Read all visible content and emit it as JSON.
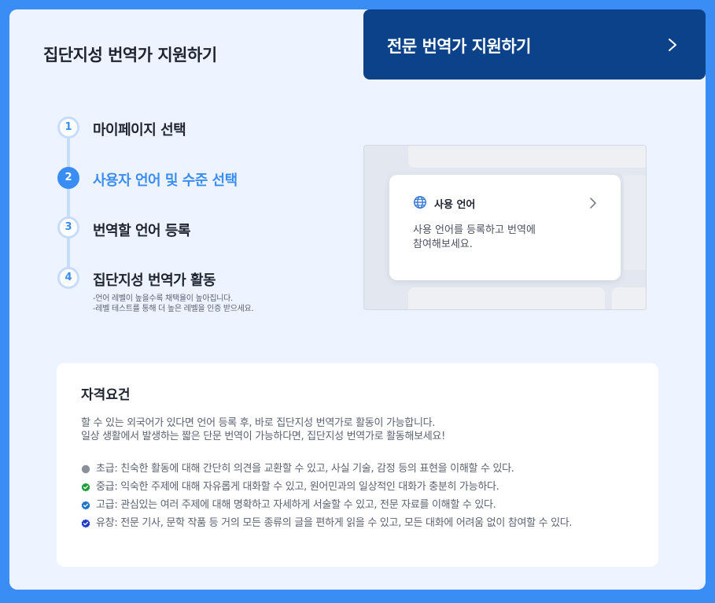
{
  "tabs": {
    "active": {
      "label": "집단지성 번역가 지원하기"
    },
    "other": {
      "label": "전문 번역가 지원하기",
      "icon": "chevron-right-icon"
    }
  },
  "steps": [
    {
      "number": "1",
      "label": "마이페이지 선택",
      "active": false
    },
    {
      "number": "2",
      "label": "사용자 언어 및 수준 선택",
      "active": true
    },
    {
      "number": "3",
      "label": "번역할 언어 등록",
      "active": false
    },
    {
      "number": "4",
      "label": "집단지성 번역가 활동",
      "active": false,
      "notes": [
        "-언어 레벨이 높을수록 채택율이 높아집니다.",
        "-레벨 테스트를 통해 더 높은 레벨을 인증 받으세요."
      ]
    }
  ],
  "preview": {
    "icon": "globe-icon",
    "title": "사용 언어",
    "description_line1": "사용 언어를 등록하고 번역에",
    "description_line2": "참여해보세요."
  },
  "requirements": {
    "title": "자격요건",
    "intro_line1": "할 수 있는 외국어가 있다면 언어 등록 후, 바로 집단지성 번역가로 활동이 가능합니다.",
    "intro_line2": "일상 생활에서 발생하는 짧은 단문 번역이 가능하다면, 집단지성 번역가로 활동해보세요!",
    "levels": [
      {
        "text": "초급: 친숙한 활동에 대해 간단히 의견을 교환할 수 있고, 사실 기술, 감정 등의 표현을 이해할 수 있다.",
        "icon": "gray-dot-icon",
        "color": "#8a8f99"
      },
      {
        "text": "중급: 익숙한 주제에 대해 자유롭게 대화할 수 있고, 원어민과의 일상적인 대화가 충분히 가능하다.",
        "icon": "green-check-badge-icon",
        "color": "#1f9d3a"
      },
      {
        "text": "고급: 관심있는 여러 주제에 대해 명확하고 자세하게 서술할 수 있고, 전문 자료를 이해할 수 있다.",
        "icon": "blue-check-badge-icon",
        "color": "#1e74c8"
      },
      {
        "text": "유창: 전문 기사, 문학 작품 등 거의 모든 종류의 글을 편하게 읽을 수 있고, 모든 대화에 어려움 없이 참여할 수 있다.",
        "icon": "navy-check-badge-icon",
        "color": "#1c3bc4"
      }
    ]
  },
  "colors": {
    "accent": "#3a8df5",
    "navy_tab": "#0c4289",
    "panel_bg": "#eef4ff",
    "step_line": "#c7dcfb"
  }
}
